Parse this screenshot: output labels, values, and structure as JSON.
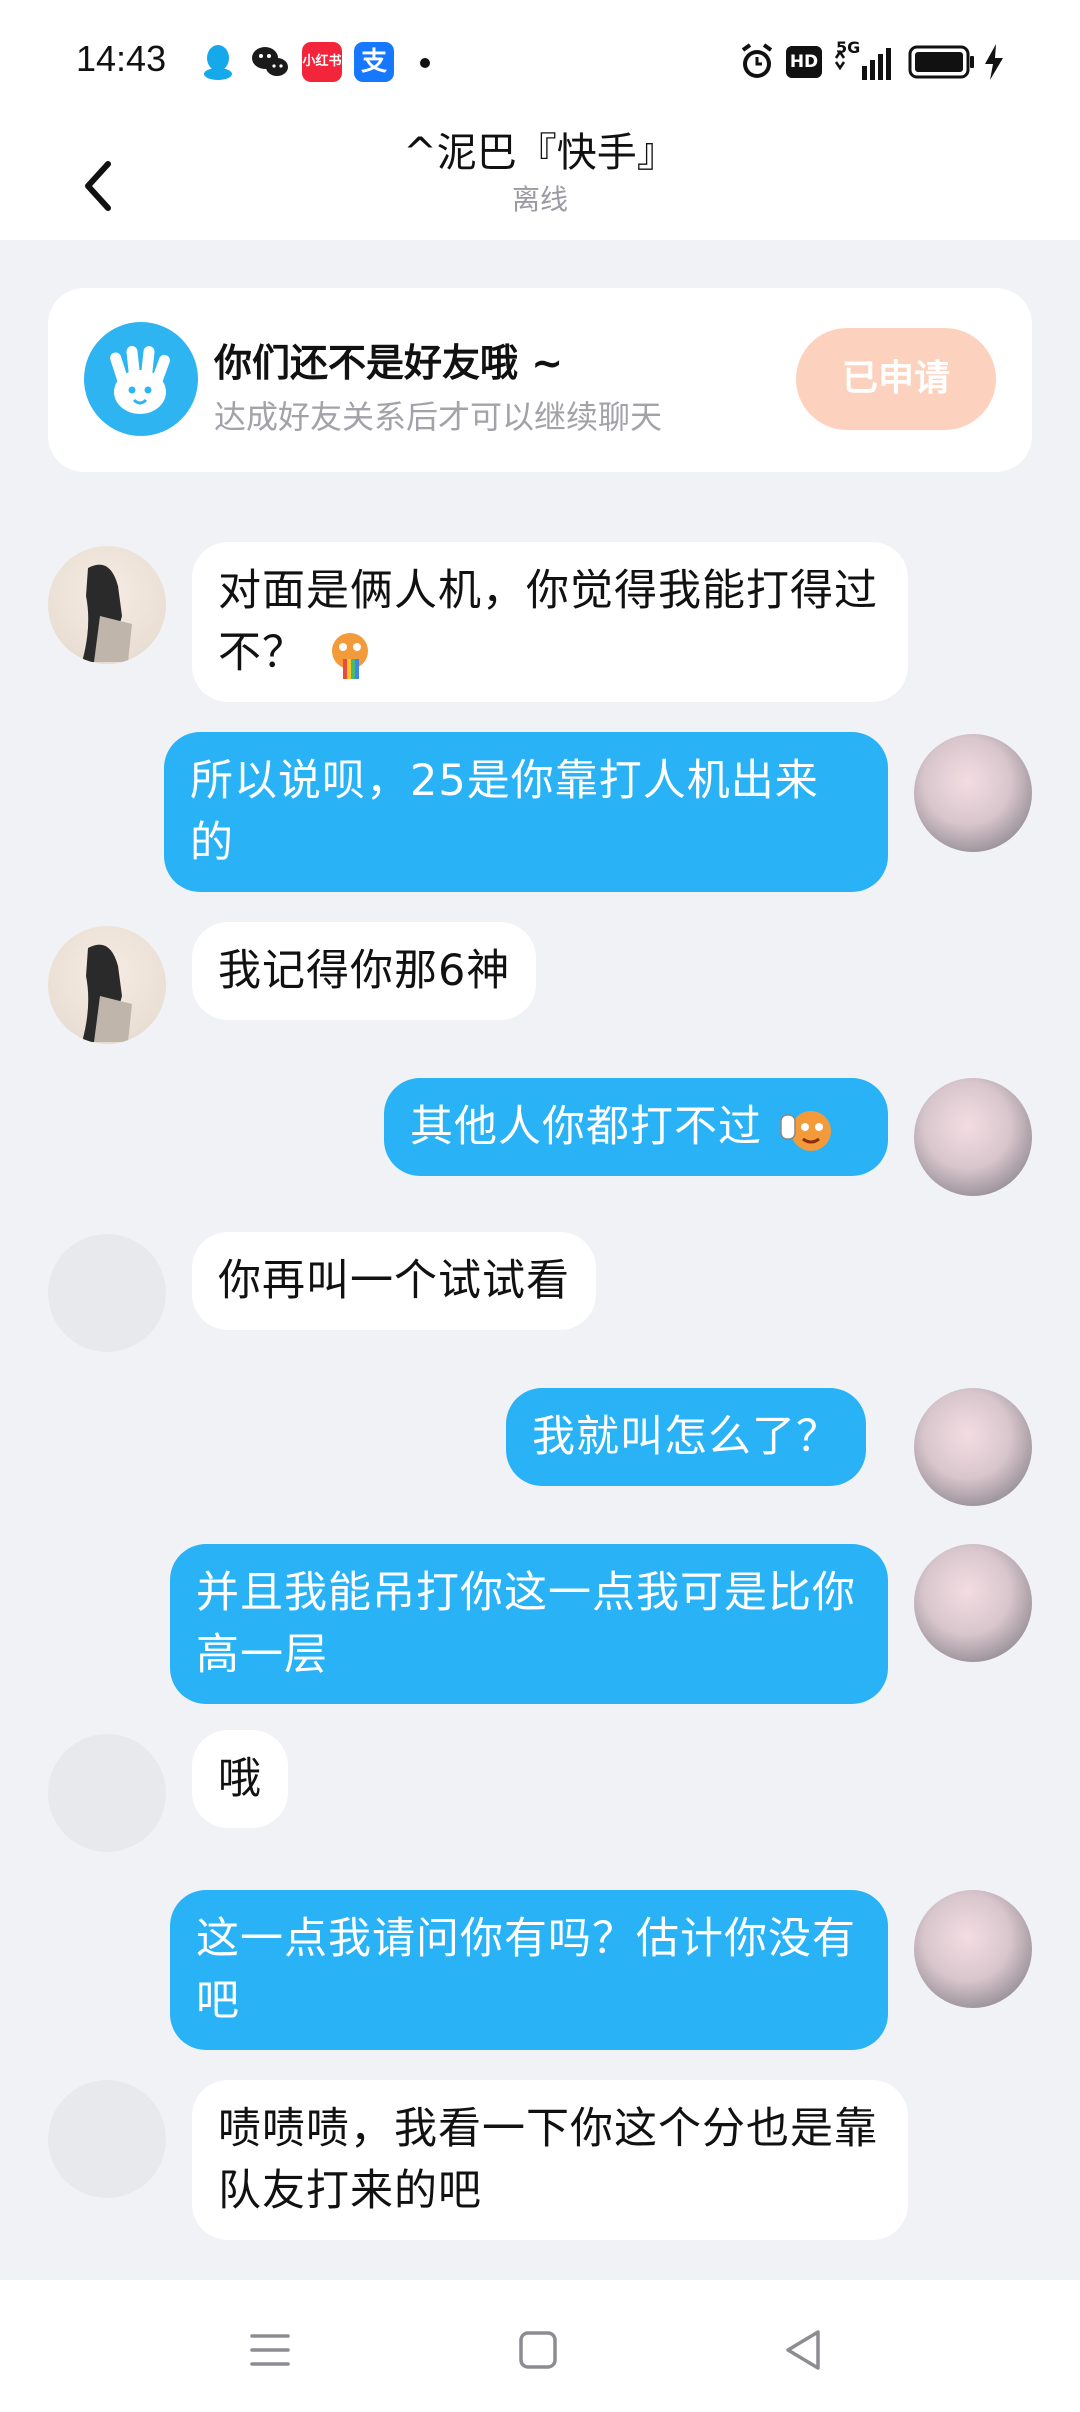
{
  "status_bar": {
    "time": "14:43",
    "apps": [
      "qq-icon",
      "wechat-icon",
      "xiaohongshu-icon",
      "alipay-icon"
    ],
    "xhs_label": "小红书",
    "alipay_label": "支",
    "network": "5G",
    "hd": "HD"
  },
  "header": {
    "title": "^泥巴『快手』",
    "subtitle": "离线"
  },
  "banner": {
    "title": "你们还不是好友哦 ~",
    "subtitle": "达成好友关系后才可以继续聊天",
    "button": "已申请"
  },
  "messages": [
    {
      "side": "in",
      "avatar": "photo",
      "text": "对面是俩人机，你觉得我能打得过不？",
      "emoji": "vomit-rainbow-emoji"
    },
    {
      "side": "out",
      "text": "所以说呗，25是你靠打人机出来的"
    },
    {
      "side": "in",
      "avatar": "photo",
      "text": "我记得你那6神"
    },
    {
      "side": "out",
      "text": "其他人你都打不过",
      "emoji": "crying-wave-emoji"
    },
    {
      "side": "in",
      "avatar": "empty",
      "text": "你再叫一个试试看"
    },
    {
      "side": "out",
      "text": "我就叫怎么了？"
    },
    {
      "side": "out",
      "text": "并且我能吊打你这一点我可是比你高一层"
    },
    {
      "side": "in",
      "avatar": "empty",
      "text": "哦"
    },
    {
      "side": "out",
      "text": "这一点我请问你有吗？估计你没有吧"
    },
    {
      "side": "in",
      "avatar": "empty",
      "text": "啧啧啧，我看一下你这个分也是靠队友打来的吧"
    }
  ],
  "nav": [
    "menu-icon",
    "home-icon",
    "back-icon"
  ]
}
